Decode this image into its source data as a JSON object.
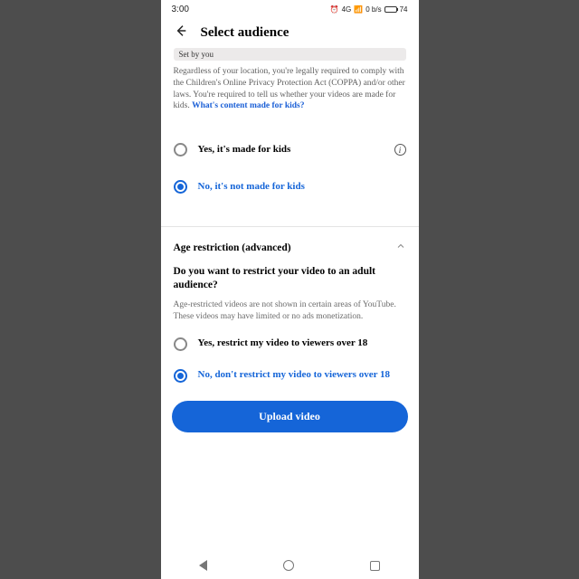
{
  "statusbar": {
    "time": "3:00",
    "net": "4G",
    "speed": "0 b/s",
    "battery": "74"
  },
  "header": {
    "title": "Select audience"
  },
  "chip": "Set by you",
  "legal_text": "Regardless of your location, you're legally required to comply with the Children's Online Privacy Protection Act (COPPA) and/or other laws. You're required to tell us whether your videos are made for kids. ",
  "legal_link": "What's content made for kids?",
  "audience": {
    "yes": "Yes, it's made for kids",
    "no": "No, it's not made for kids"
  },
  "age_section": {
    "heading": "Age restriction (advanced)",
    "question": "Do you want to restrict your video to an adult audience?",
    "desc": "Age-restricted videos are not shown in certain areas of YouTube. These videos may have limited or no ads monetization.",
    "yes": "Yes, restrict my video to viewers over 18",
    "no": "No, don't restrict my video to viewers over 18"
  },
  "cta": "Upload video"
}
